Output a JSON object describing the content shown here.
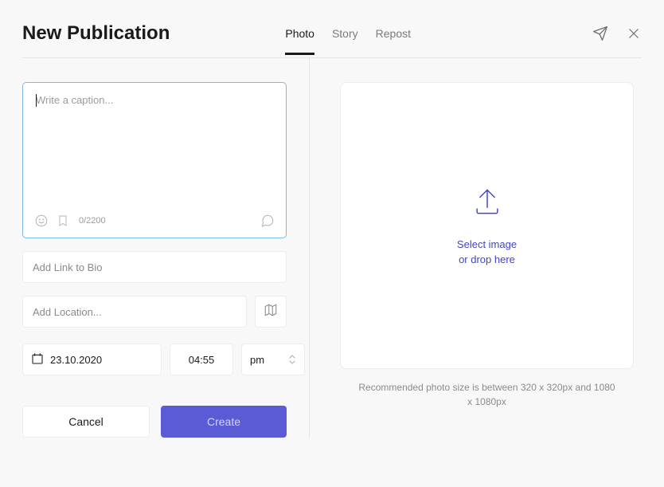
{
  "header": {
    "title": "New Publication",
    "tabs": [
      {
        "label": "Photo",
        "active": true
      },
      {
        "label": "Story",
        "active": false
      },
      {
        "label": "Repost",
        "active": false
      }
    ]
  },
  "caption": {
    "placeholder": "Write a caption...",
    "char_count": "0/2200"
  },
  "fields": {
    "bio_link_placeholder": "Add Link to Bio",
    "location_placeholder": "Add Location...",
    "date_value": "23.10.2020",
    "time_value": "04:55",
    "ampm_value": "pm"
  },
  "actions": {
    "cancel_label": "Cancel",
    "create_label": "Create"
  },
  "dropzone": {
    "line1": "Select image",
    "line2": "or drop here",
    "hint": "Recommended photo size is between 320 x 320px and 1080 x 1080px"
  }
}
